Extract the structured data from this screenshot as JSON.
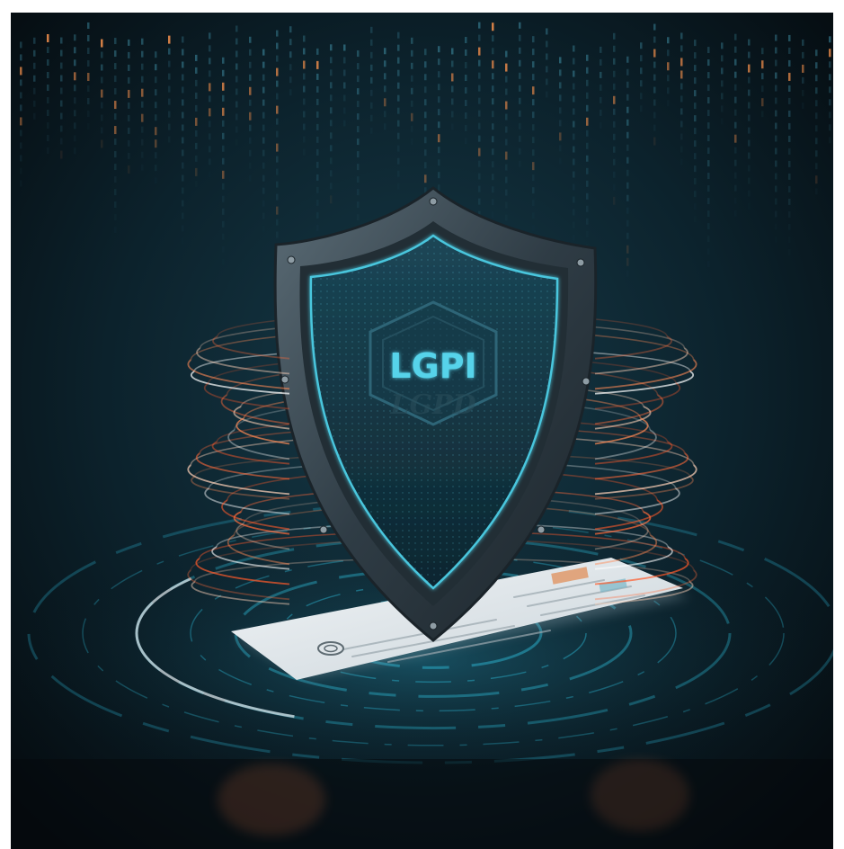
{
  "image": {
    "shield_text": "LGPI",
    "shield_subtext": "LGPD",
    "colors": {
      "background_top": "#0e232d",
      "background_bottom": "#05090c",
      "shield_metal": "#3d4d57",
      "shield_face": "#14323f",
      "accent_cyan": "#3fd4ea",
      "accent_orange": "#ff6a3a",
      "binary_orange": "#e8894a"
    },
    "icons": [
      "shield-icon",
      "document-icon",
      "stamp-icon",
      "binary-rain",
      "circuit-rings",
      "orange-swirl"
    ]
  }
}
